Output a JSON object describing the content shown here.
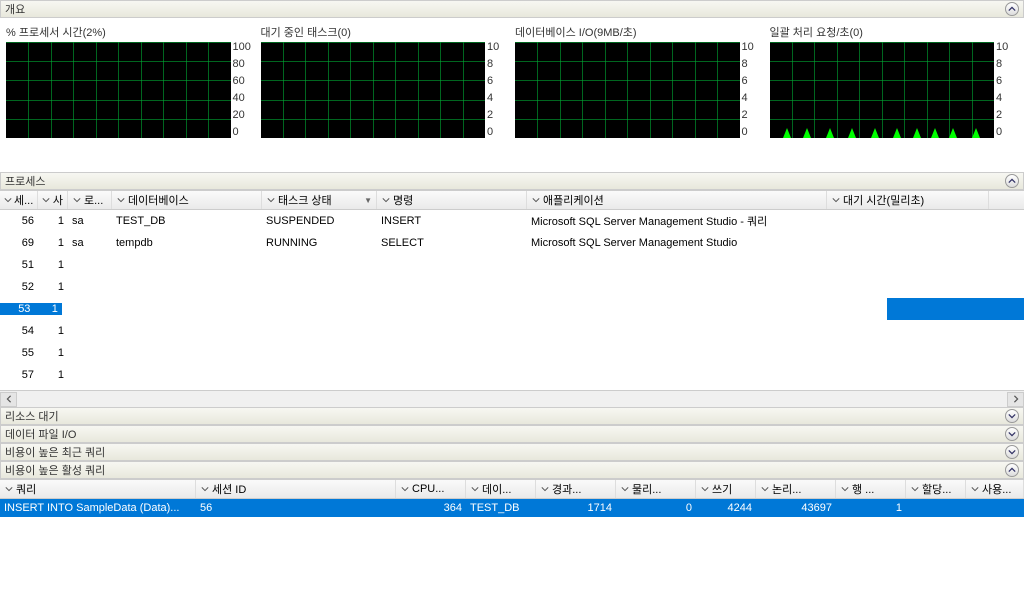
{
  "overview": {
    "title": "개요"
  },
  "charts": [
    {
      "label": "% 프로세서 시간(2%)",
      "ticks": [
        "100",
        "80",
        "60",
        "40",
        "20",
        "0"
      ],
      "spikes": false
    },
    {
      "label": "대기 중인 태스크(0)",
      "ticks": [
        "10",
        "8",
        "6",
        "4",
        "2",
        "0"
      ],
      "spikes": false
    },
    {
      "label": "데이터베이스 I/O(9MB/초)",
      "ticks": [
        "10",
        "8",
        "6",
        "4",
        "2",
        "0"
      ],
      "spikes": false
    },
    {
      "label": "일괄 처리 요청/초(0)",
      "ticks": [
        "10",
        "8",
        "6",
        "4",
        "2",
        "0"
      ],
      "spikes": true
    }
  ],
  "processes": {
    "title": "프로세스",
    "columns": [
      "세...",
      "사",
      "로...",
      "데이터베이스",
      "태스크 상태",
      "명령",
      "애플리케이션",
      "대기 시간(밀리초)"
    ],
    "widths": [
      38,
      30,
      44,
      150,
      115,
      150,
      300,
      162
    ],
    "rows": [
      {
        "c": [
          "56",
          "1",
          "sa",
          "TEST_DB",
          "SUSPENDED",
          "INSERT",
          "Microsoft SQL Server Management Studio - 쿼리",
          ""
        ],
        "sel": false
      },
      {
        "c": [
          "69",
          "1",
          "sa",
          "tempdb",
          "RUNNING",
          "SELECT",
          "Microsoft SQL Server Management Studio",
          ""
        ],
        "sel": false
      },
      {
        "c": [
          "51",
          "1",
          "",
          "",
          "",
          "",
          "",
          ""
        ],
        "sel": false
      },
      {
        "c": [
          "52",
          "1",
          "",
          "",
          "",
          "",
          "",
          ""
        ],
        "sel": false
      },
      {
        "c": [
          "53",
          "1",
          "",
          "",
          "",
          "",
          "",
          ""
        ],
        "sel": true
      },
      {
        "c": [
          "54",
          "1",
          "",
          "",
          "",
          "",
          "",
          ""
        ],
        "sel": false
      },
      {
        "c": [
          "55",
          "1",
          "",
          "",
          "",
          "",
          "",
          ""
        ],
        "sel": false
      },
      {
        "c": [
          "57",
          "1",
          "",
          "",
          "",
          "",
          "",
          ""
        ],
        "sel": false
      }
    ]
  },
  "panels": [
    "리소스 대기",
    "데이터 파일 I/O",
    "비용이 높은 최근 쿼리",
    "비용이 높은 활성 쿼리"
  ],
  "activeQueries": {
    "columns": [
      "쿼리",
      "세션 ID",
      "CPU...",
      "데이...",
      "경과...",
      "물리...",
      "쓰기",
      "논리...",
      "행 ...",
      "할당...",
      "사용..."
    ],
    "widths": [
      196,
      200,
      70,
      70,
      80,
      80,
      60,
      80,
      70,
      60,
      58
    ],
    "row": [
      "INSERT INTO SampleData (Data)...",
      "56",
      "364",
      "TEST_DB",
      "1714",
      "0",
      "4244",
      "43697",
      "1",
      "",
      ""
    ]
  },
  "chart_data": [
    {
      "type": "line",
      "title": "% 프로세서 시간(2%)",
      "ylim": [
        0,
        100
      ],
      "values": []
    },
    {
      "type": "line",
      "title": "대기 중인 태스크(0)",
      "ylim": [
        0,
        10
      ],
      "values": []
    },
    {
      "type": "line",
      "title": "데이터베이스 I/O(9MB/초)",
      "ylim": [
        0,
        10
      ],
      "values": []
    },
    {
      "type": "line",
      "title": "일괄 처리 요청/초(0)",
      "ylim": [
        0,
        10
      ],
      "values": [
        1,
        1,
        1,
        1,
        1,
        1,
        1,
        1,
        1,
        1
      ]
    }
  ]
}
